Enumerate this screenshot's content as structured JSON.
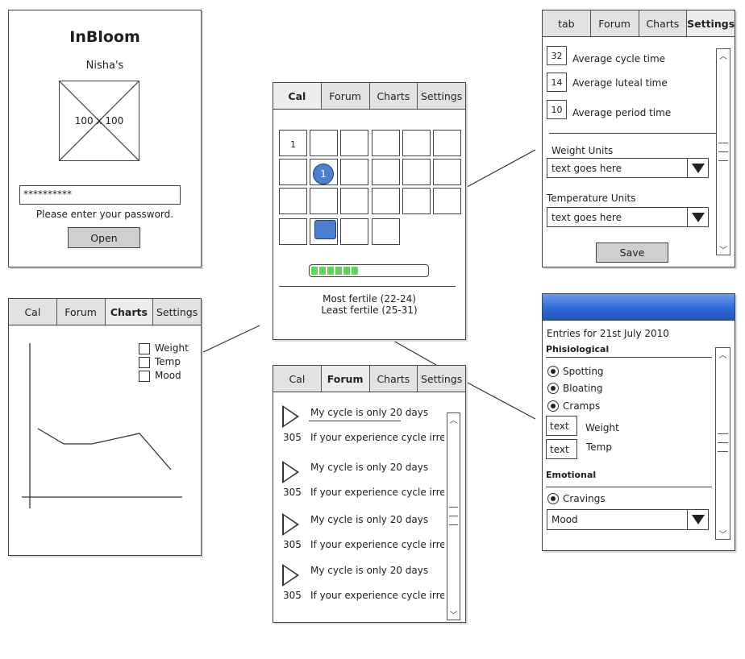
{
  "login": {
    "title": "InBloom",
    "subtitle": "Nisha's",
    "image_label": "100 x 100",
    "password_value": "**********",
    "password_hint": "Please enter your password.",
    "open_label": "Open"
  },
  "calendar": {
    "tabs": [
      "Cal",
      "Forum",
      "Charts",
      "Settings"
    ],
    "first_day": "1",
    "marker": "1",
    "progress": 0.4,
    "most_fertile": "Most fertile (22-24)",
    "least_fertile": "Least fertile (25-31)"
  },
  "settings": {
    "tabs": [
      "tab",
      "Forum",
      "Charts",
      "Settings"
    ],
    "avg_cycle_value": "32",
    "avg_cycle_label": "Average cycle time",
    "avg_luteal_value": "14",
    "avg_luteal_label": "Average luteal time",
    "avg_period_value": "10",
    "avg_period_label": "Average period time",
    "weight_units_label": "Weight Units",
    "weight_units_value": "text goes here",
    "temp_units_label": "Temperature Units",
    "temp_units_value": "text goes here",
    "save_label": "Save"
  },
  "charts": {
    "tabs": [
      "Cal",
      "Forum",
      "Charts",
      "Settings"
    ],
    "legend": [
      "Weight",
      "Temp",
      "Mood"
    ]
  },
  "forum": {
    "tabs": [
      "Cal",
      "Forum",
      "Charts",
      "Settings"
    ],
    "posts": [
      {
        "title": "My cycle is only 20 days",
        "count": "305",
        "excerpt": "If your experience cycle irreg"
      },
      {
        "title": "My cycle is only 20 days",
        "count": "305",
        "excerpt": "If your experience cycle irreg"
      },
      {
        "title": "My cycle is only 20 days",
        "count": "305",
        "excerpt": "If your experience cycle irreg"
      },
      {
        "title": "My cycle is only 20 days",
        "count": "305",
        "excerpt": "If your experience cycle irreg"
      }
    ]
  },
  "entries": {
    "header_color": "#2f6bd8",
    "title": "Entries for 21st July 2010",
    "physiological_label": "Phisiological",
    "spotting": "Spotting",
    "bloating": "Bloating",
    "cramps": "Cramps",
    "weight_value": "text",
    "weight_label": "Weight",
    "temp_value": "text",
    "temp_label": "Temp",
    "emotional_label": "Emotional",
    "cravings": "Cravings",
    "mood_value": "Mood"
  }
}
